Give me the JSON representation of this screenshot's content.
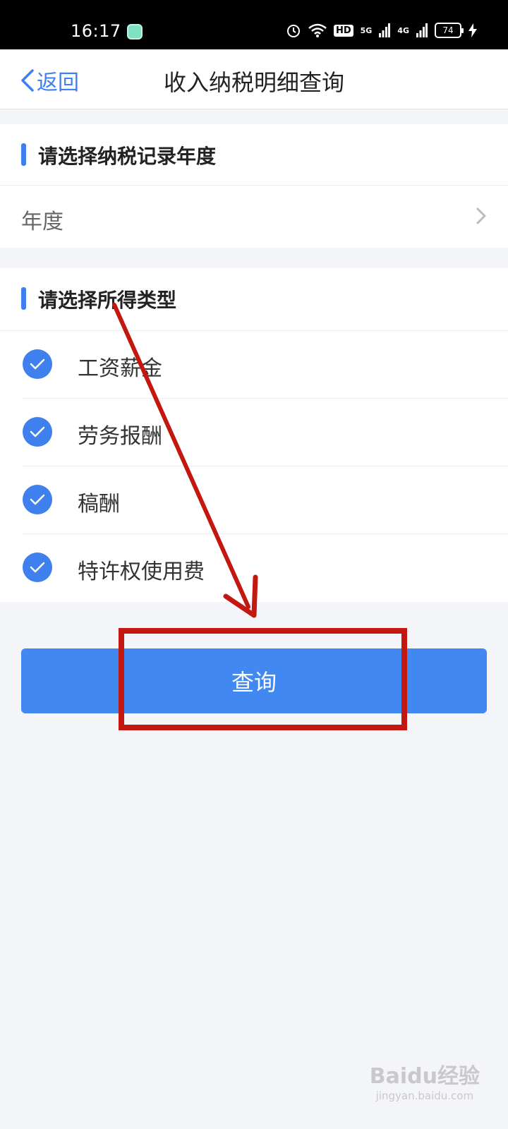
{
  "status_bar": {
    "time": "16:17",
    "hd_label": "HD",
    "net1": "5G",
    "net2": "4G",
    "battery": "74"
  },
  "nav": {
    "back_label": "返回",
    "title": "收入纳税明细查询"
  },
  "year_section": {
    "heading": "请选择纳税记录年度",
    "field_label": "年度"
  },
  "income_section": {
    "heading": "请选择所得类型",
    "items": [
      {
        "label": "工资薪金",
        "checked": true
      },
      {
        "label": "劳务报酬",
        "checked": true
      },
      {
        "label": "稿酬",
        "checked": true
      },
      {
        "label": "特许权使用费",
        "checked": true
      }
    ]
  },
  "query_button": {
    "label": "查询"
  },
  "watermark": {
    "main": "Baidu经验",
    "sub": "jingyan.baidu.com"
  },
  "colors": {
    "accent": "#3f80ef",
    "button": "#4188f0",
    "annotation": "#c3170f"
  }
}
